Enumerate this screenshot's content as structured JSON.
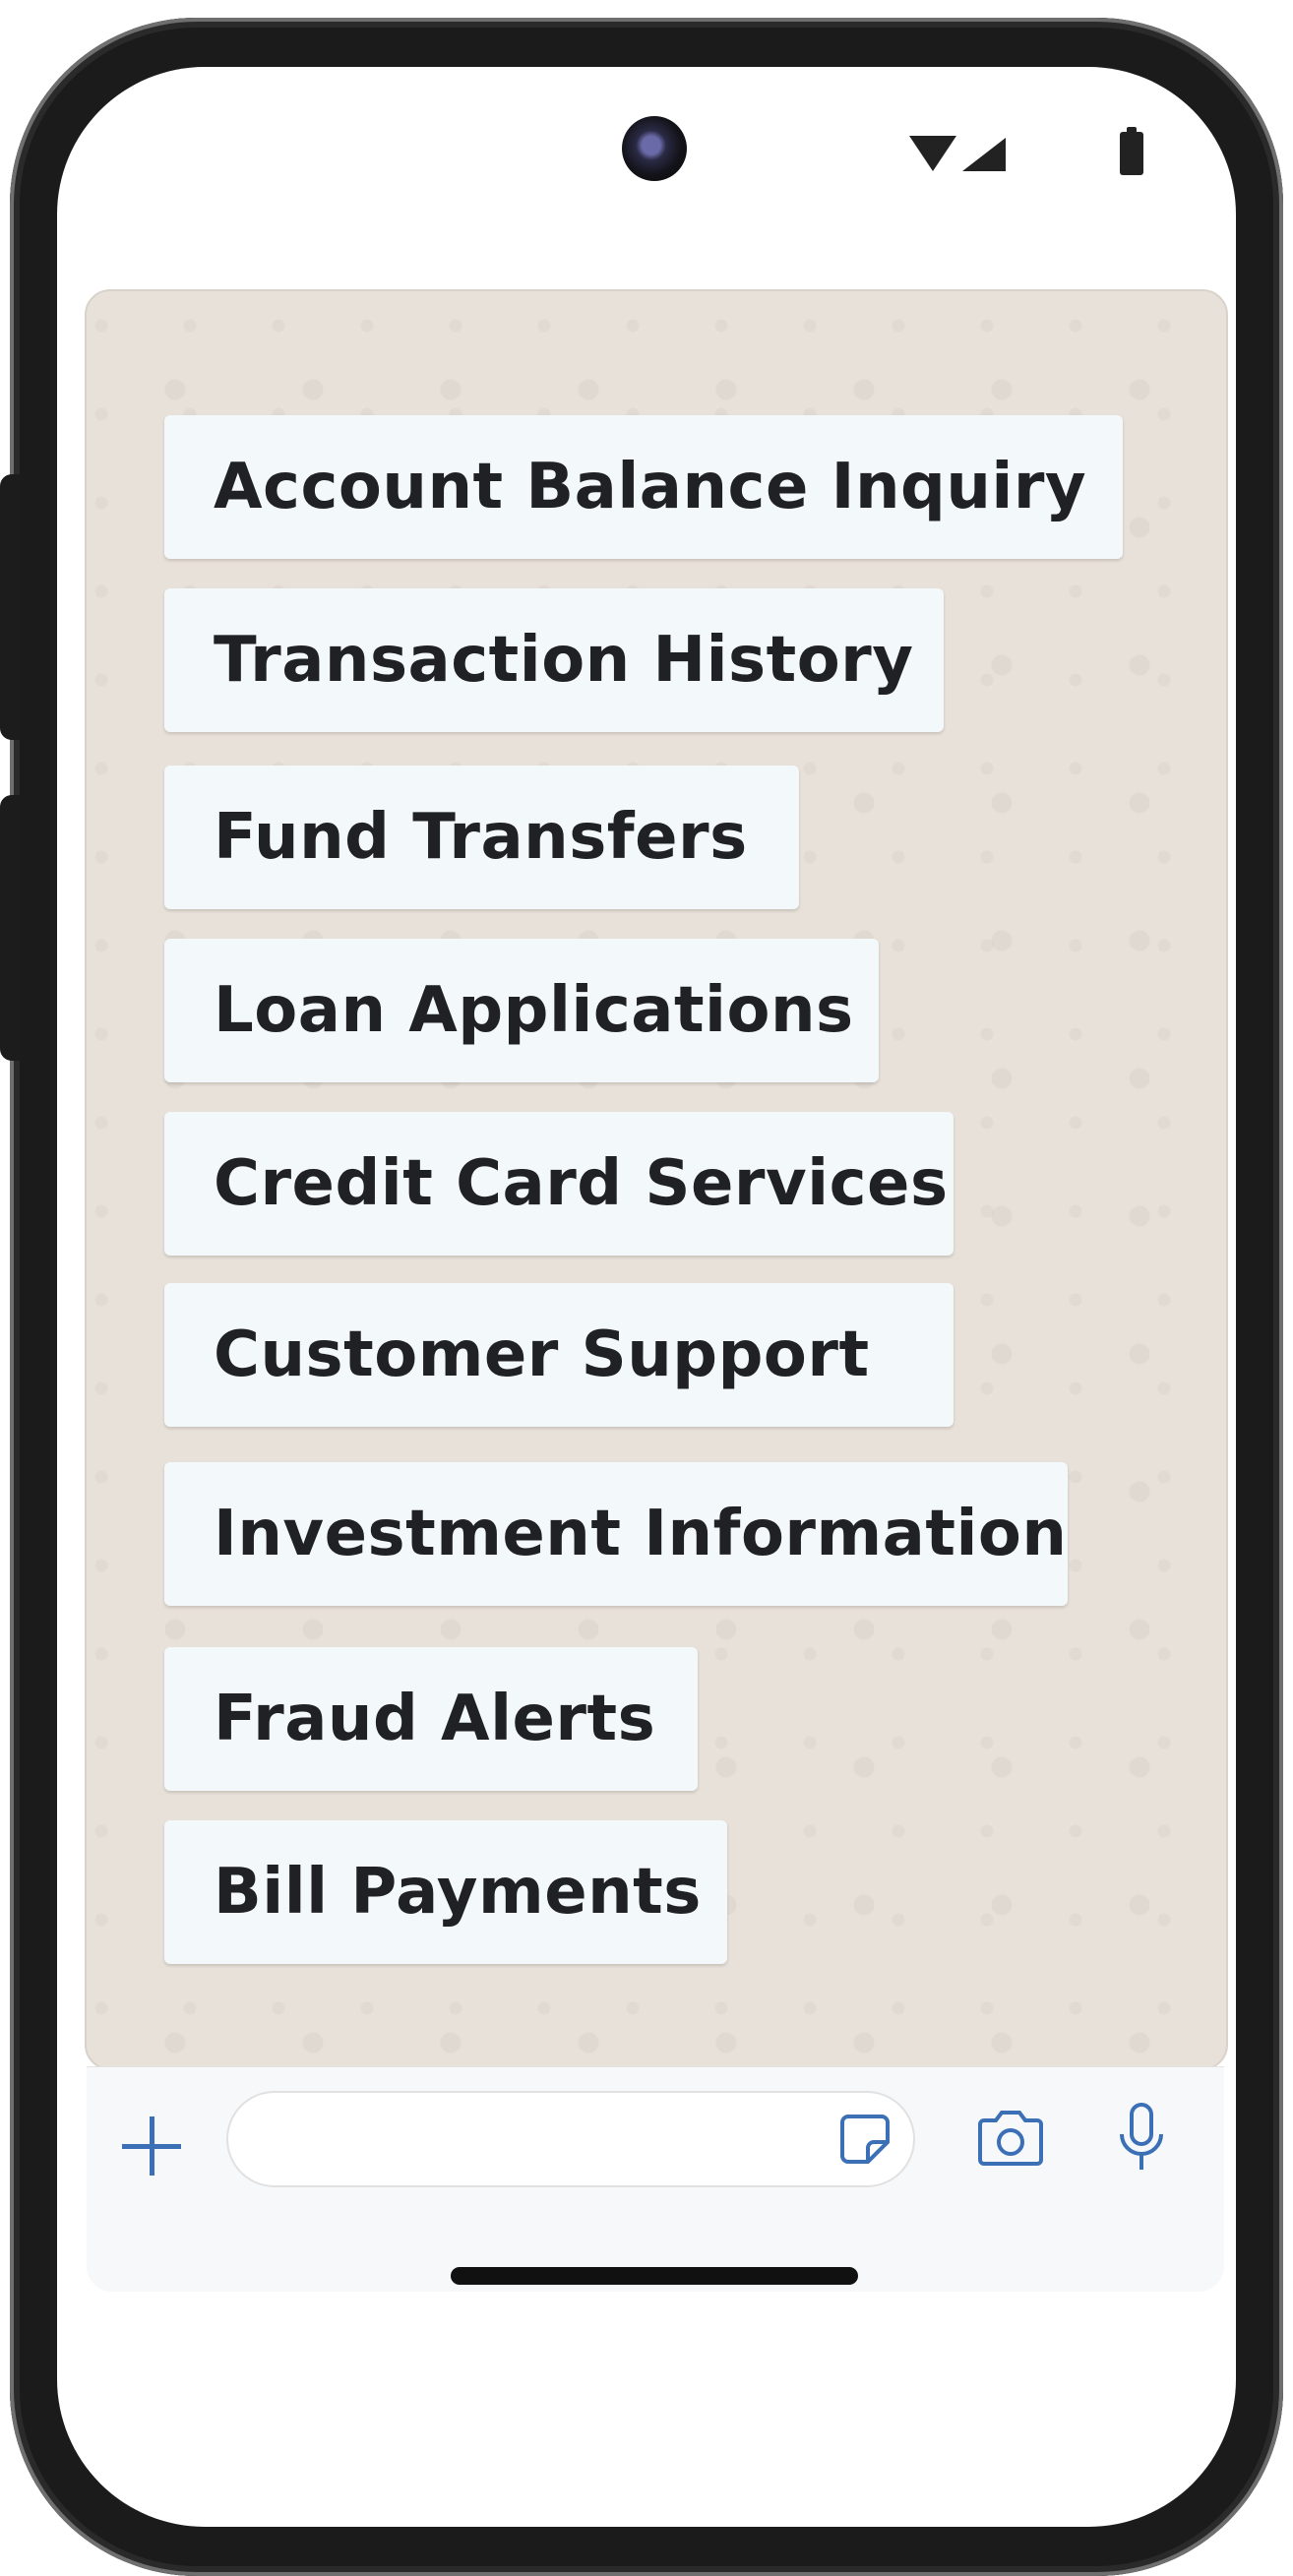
{
  "status_bar": {
    "icons": [
      "camera-icon",
      "wifi-icon",
      "signal-icon",
      "battery-icon"
    ]
  },
  "options": [
    {
      "label": "Account Balance Inquiry"
    },
    {
      "label": "Transaction History"
    },
    {
      "label": "Fund Transfers"
    },
    {
      "label": "Loan Applications"
    },
    {
      "label": "Credit Card Services"
    },
    {
      "label": "Customer Support"
    },
    {
      "label": "Investment Information"
    },
    {
      "label": "Fraud Alerts"
    },
    {
      "label": "Bill Payments"
    }
  ],
  "input_bar": {
    "placeholder": "",
    "icons": [
      "plus-icon",
      "sticker-icon",
      "camera-icon",
      "mic-icon"
    ]
  },
  "colors": {
    "accent": "#3b6fb6",
    "chat_background": "#e8e1d9",
    "option_background": "#f3f8fb"
  }
}
